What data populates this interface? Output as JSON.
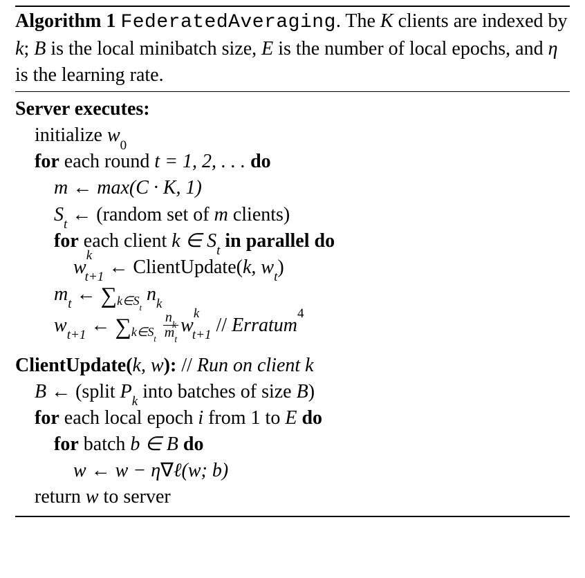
{
  "caption": {
    "label": "Algorithm 1",
    "name_tt": "FederatedAveraging",
    "desc_a": ". The ",
    "K": "K",
    "desc_b": " clients are indexed by ",
    "k": "k",
    "desc_c": "; ",
    "B": "B",
    "desc_d": " is the local minibatch size, ",
    "E": "E",
    "desc_e": " is the number of local epochs, and ",
    "eta": "η",
    "desc_f": " is the learning rate."
  },
  "server": {
    "heading": "Server executes:",
    "init_a": "initialize ",
    "init_w0": "w",
    "init_w0_sub": "0",
    "for_round_a": "for",
    "for_round_b": " each round ",
    "for_round_c": "t = 1, 2, . . . ",
    "do": "do",
    "m_assign_a": "m ←  max(",
    "m_assign_b": "C · K, 1)",
    "St_a": "S",
    "St_sub": "t",
    "St_b": " ← (random set of ",
    "St_c": "m",
    "St_d": " clients)",
    "for_client_a": "for",
    "for_client_b": " each client ",
    "for_client_c": "k ∈ S",
    "for_client_c_sub": "t",
    "for_client_d": " in parallel do",
    "w_up_a": "w",
    "w_up_sub": "t+1",
    "w_up_sup": "k",
    "w_up_b": " ← ClientUpdate(",
    "w_up_c": "k, w",
    "w_up_c_sub": "t",
    "w_up_d": ")",
    "mt_a": "m",
    "mt_sub": "t",
    "mt_b": " ← ",
    "sum_sub": "k∈S",
    "sum_sub2": "t",
    "mt_nk": " n",
    "mt_nk_sub": "k",
    "wagg_a": "w",
    "wagg_sub": "t+1",
    "wagg_b": " ← ",
    "frac_num_a": "n",
    "frac_num_sub": "k",
    "frac_den_a": "m",
    "frac_den_sub": "t",
    "wagg_c": "w",
    "wagg_c_sub": "t+1",
    "wagg_c_sup": "k",
    "erratum_sep": "   // ",
    "erratum": "Erratum",
    "erratum_sup": "4"
  },
  "client": {
    "heading_a": "ClientUpdate(",
    "heading_b": "k, w",
    "heading_c": "):",
    "comment_sep": "   // ",
    "comment": "Run on client k",
    "B_a": "B",
    "B_b": " ← (split ",
    "B_Pk": "P",
    "B_Pk_sub": "k",
    "B_c": " into batches of size ",
    "B_d": "B",
    "B_e": ")",
    "for_epoch_a": "for",
    "for_epoch_b": " each local epoch ",
    "for_epoch_c": "i",
    "for_epoch_d": " from 1 to ",
    "for_epoch_e": "E ",
    "do": "do",
    "for_batch_a": "for",
    "for_batch_b": " batch ",
    "for_batch_c": "b ∈ ",
    "for_batch_calB": "B",
    "for_batch_do": " do",
    "update_a": "w ← w − η",
    "update_nabla": "∇",
    "update_ell": "ℓ",
    "update_b": "(w; b)",
    "return_a": "return ",
    "return_b": "w",
    "return_c": " to server"
  }
}
